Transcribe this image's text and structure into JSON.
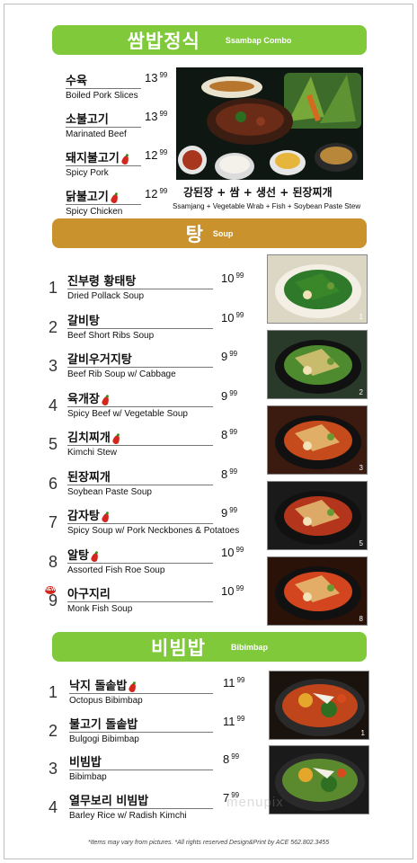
{
  "sections": {
    "ssambap": {
      "ko": "쌈밥정식",
      "en": "Ssambap Combo",
      "color": "#7fc93a"
    },
    "soup": {
      "ko": "탕",
      "en": "Soup",
      "color": "#c9922d"
    },
    "bibimbap": {
      "ko": "비빔밥",
      "en": "Bibimbap",
      "color": "#7fc93a"
    }
  },
  "ssambap_items": [
    {
      "ko": "수육",
      "en": "Boiled Pork Slices",
      "price": "13",
      "cents": "99",
      "spicy": false
    },
    {
      "ko": "소불고기",
      "en": "Marinated Beef",
      "price": "13",
      "cents": "99",
      "spicy": false
    },
    {
      "ko": "돼지불고기",
      "en": "Spicy Pork",
      "price": "12",
      "cents": "99",
      "spicy": true
    },
    {
      "ko": "닭불고기",
      "en": "Spicy Chicken",
      "price": "12",
      "cents": "99",
      "spicy": true
    }
  ],
  "combo_caption": {
    "ko": "강된장 + 쌈 + 생선 + 된장찌개",
    "en": "Ssamjang + Vegetable Wrab + Fish + Soybean Paste Stew"
  },
  "soup_items": [
    {
      "num": "1",
      "ko": "진부령 황태탕",
      "en": "Dried Pollack Soup",
      "price": "10",
      "cents": "99",
      "spicy": false
    },
    {
      "num": "2",
      "ko": "갈비탕",
      "en": "Beef Short Ribs Soup",
      "price": "10",
      "cents": "99",
      "spicy": false
    },
    {
      "num": "3",
      "ko": "갈비우거지탕",
      "en": "Beef Rib Soup w/ Cabbage",
      "price": "9",
      "cents": "99",
      "spicy": false
    },
    {
      "num": "4",
      "ko": "육개장",
      "en": "Spicy Beef w/ Vegetable Soup",
      "price": "9",
      "cents": "99",
      "spicy": true
    },
    {
      "num": "5",
      "ko": "김치찌개",
      "en": "Kimchi Stew",
      "price": "8",
      "cents": "99",
      "spicy": true
    },
    {
      "num": "6",
      "ko": "된장찌개",
      "en": "Soybean Paste Soup",
      "price": "8",
      "cents": "99",
      "spicy": false
    },
    {
      "num": "7",
      "ko": "감자탕",
      "en": "Spicy Soup w/ Pork Neckbones & Potatoes",
      "price": "9",
      "cents": "99",
      "spicy": true
    },
    {
      "num": "8",
      "ko": "알탕",
      "en": "Assorted Fish Roe Soup",
      "price": "10",
      "cents": "99",
      "spicy": true
    },
    {
      "num": "9",
      "ko": "아구지리",
      "en": "Monk Fish Soup",
      "price": "10",
      "cents": "99",
      "spicy": false,
      "badge": "NEW"
    }
  ],
  "soup_photo_tags": [
    "1",
    "2",
    "3",
    "5",
    "8"
  ],
  "bibimbap_items": [
    {
      "num": "1",
      "ko": "낙지 돌솥밥",
      "en": "Octopus Bibimbap",
      "price": "11",
      "cents": "99",
      "spicy": true
    },
    {
      "num": "2",
      "ko": "불고기 돌솥밥",
      "en": "Bulgogi Bibimbap",
      "price": "11",
      "cents": "99",
      "spicy": false
    },
    {
      "num": "3",
      "ko": "비빔밥",
      "en": "Bibimbap",
      "price": "8",
      "cents": "99",
      "spicy": false
    },
    {
      "num": "4",
      "ko": "열무보리 비빔밥",
      "en": "Barley Rice w/ Radish Kimchi",
      "price": "7",
      "cents": "99",
      "spicy": false
    }
  ],
  "bibimbap_photo_tags": [
    "1",
    ""
  ],
  "watermark": "menupix",
  "footer": "*Items may vary from pictures.   *All rights reserved      Design&Print by ACE 562.802.3455"
}
